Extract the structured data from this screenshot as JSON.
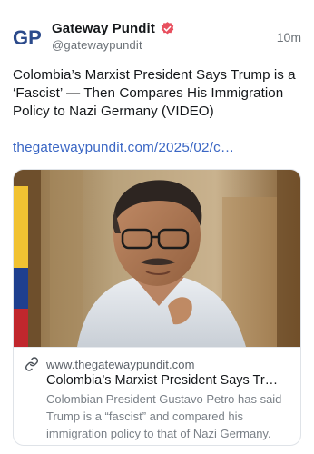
{
  "post": {
    "author": {
      "display_name": "Gateway Pundit",
      "handle": "@gatewaypundit",
      "avatar_text": "GP",
      "verified_icon": "verified-badge-icon"
    },
    "timestamp": "10m",
    "text": "Colombia’s Marxist President Says Trump is a ‘Fascist’ — Then Compares His Immigration Policy to Nazi Germany (VIDEO)",
    "link_text": "thegatewaypundit.com/2025/02/c…"
  },
  "card": {
    "image_icon": "president-photo",
    "link_icon": "link-icon",
    "domain": "www.thegatewaypundit.com",
    "title": "Colombia’s Marxist President Says Tr…",
    "description": "Colombian President Gustavo Petro has said Trump is a “fascist” and compared his immigration policy to that of Nazi Germany."
  },
  "colors": {
    "link": "#3a66c4",
    "verified": "#e8505f",
    "avatar_blue": "#2b4a8b",
    "avatar_red": "#d23a2e",
    "muted_text": "#6b7177"
  }
}
